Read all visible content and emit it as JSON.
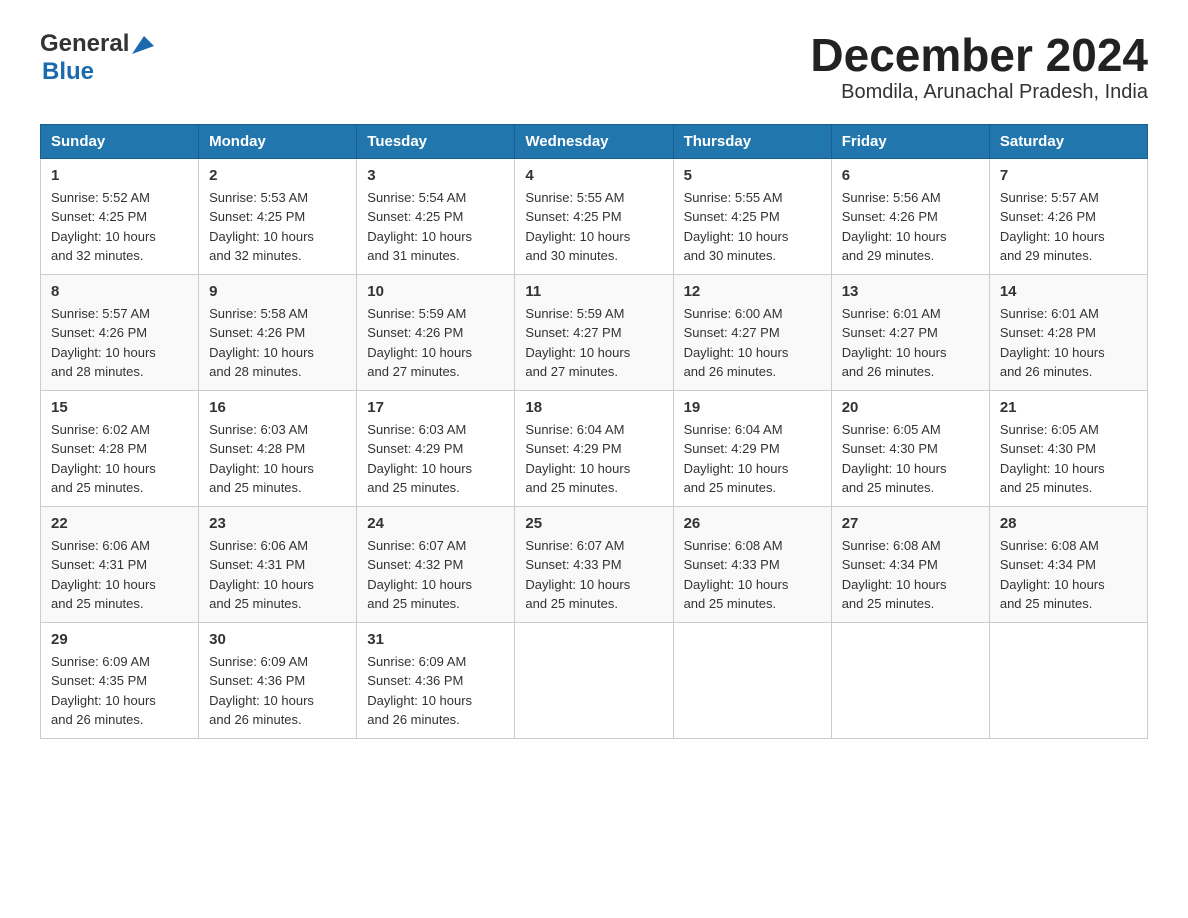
{
  "header": {
    "title": "December 2024",
    "subtitle": "Bomdila, Arunachal Pradesh, India",
    "logo_general": "General",
    "logo_blue": "Blue"
  },
  "weekdays": [
    "Sunday",
    "Monday",
    "Tuesday",
    "Wednesday",
    "Thursday",
    "Friday",
    "Saturday"
  ],
  "weeks": [
    [
      {
        "day": "1",
        "sunrise": "5:52 AM",
        "sunset": "4:25 PM",
        "daylight": "10 hours and 32 minutes."
      },
      {
        "day": "2",
        "sunrise": "5:53 AM",
        "sunset": "4:25 PM",
        "daylight": "10 hours and 32 minutes."
      },
      {
        "day": "3",
        "sunrise": "5:54 AM",
        "sunset": "4:25 PM",
        "daylight": "10 hours and 31 minutes."
      },
      {
        "day": "4",
        "sunrise": "5:55 AM",
        "sunset": "4:25 PM",
        "daylight": "10 hours and 30 minutes."
      },
      {
        "day": "5",
        "sunrise": "5:55 AM",
        "sunset": "4:25 PM",
        "daylight": "10 hours and 30 minutes."
      },
      {
        "day": "6",
        "sunrise": "5:56 AM",
        "sunset": "4:26 PM",
        "daylight": "10 hours and 29 minutes."
      },
      {
        "day": "7",
        "sunrise": "5:57 AM",
        "sunset": "4:26 PM",
        "daylight": "10 hours and 29 minutes."
      }
    ],
    [
      {
        "day": "8",
        "sunrise": "5:57 AM",
        "sunset": "4:26 PM",
        "daylight": "10 hours and 28 minutes."
      },
      {
        "day": "9",
        "sunrise": "5:58 AM",
        "sunset": "4:26 PM",
        "daylight": "10 hours and 28 minutes."
      },
      {
        "day": "10",
        "sunrise": "5:59 AM",
        "sunset": "4:26 PM",
        "daylight": "10 hours and 27 minutes."
      },
      {
        "day": "11",
        "sunrise": "5:59 AM",
        "sunset": "4:27 PM",
        "daylight": "10 hours and 27 minutes."
      },
      {
        "day": "12",
        "sunrise": "6:00 AM",
        "sunset": "4:27 PM",
        "daylight": "10 hours and 26 minutes."
      },
      {
        "day": "13",
        "sunrise": "6:01 AM",
        "sunset": "4:27 PM",
        "daylight": "10 hours and 26 minutes."
      },
      {
        "day": "14",
        "sunrise": "6:01 AM",
        "sunset": "4:28 PM",
        "daylight": "10 hours and 26 minutes."
      }
    ],
    [
      {
        "day": "15",
        "sunrise": "6:02 AM",
        "sunset": "4:28 PM",
        "daylight": "10 hours and 25 minutes."
      },
      {
        "day": "16",
        "sunrise": "6:03 AM",
        "sunset": "4:28 PM",
        "daylight": "10 hours and 25 minutes."
      },
      {
        "day": "17",
        "sunrise": "6:03 AM",
        "sunset": "4:29 PM",
        "daylight": "10 hours and 25 minutes."
      },
      {
        "day": "18",
        "sunrise": "6:04 AM",
        "sunset": "4:29 PM",
        "daylight": "10 hours and 25 minutes."
      },
      {
        "day": "19",
        "sunrise": "6:04 AM",
        "sunset": "4:29 PM",
        "daylight": "10 hours and 25 minutes."
      },
      {
        "day": "20",
        "sunrise": "6:05 AM",
        "sunset": "4:30 PM",
        "daylight": "10 hours and 25 minutes."
      },
      {
        "day": "21",
        "sunrise": "6:05 AM",
        "sunset": "4:30 PM",
        "daylight": "10 hours and 25 minutes."
      }
    ],
    [
      {
        "day": "22",
        "sunrise": "6:06 AM",
        "sunset": "4:31 PM",
        "daylight": "10 hours and 25 minutes."
      },
      {
        "day": "23",
        "sunrise": "6:06 AM",
        "sunset": "4:31 PM",
        "daylight": "10 hours and 25 minutes."
      },
      {
        "day": "24",
        "sunrise": "6:07 AM",
        "sunset": "4:32 PM",
        "daylight": "10 hours and 25 minutes."
      },
      {
        "day": "25",
        "sunrise": "6:07 AM",
        "sunset": "4:33 PM",
        "daylight": "10 hours and 25 minutes."
      },
      {
        "day": "26",
        "sunrise": "6:08 AM",
        "sunset": "4:33 PM",
        "daylight": "10 hours and 25 minutes."
      },
      {
        "day": "27",
        "sunrise": "6:08 AM",
        "sunset": "4:34 PM",
        "daylight": "10 hours and 25 minutes."
      },
      {
        "day": "28",
        "sunrise": "6:08 AM",
        "sunset": "4:34 PM",
        "daylight": "10 hours and 25 minutes."
      }
    ],
    [
      {
        "day": "29",
        "sunrise": "6:09 AM",
        "sunset": "4:35 PM",
        "daylight": "10 hours and 26 minutes."
      },
      {
        "day": "30",
        "sunrise": "6:09 AM",
        "sunset": "4:36 PM",
        "daylight": "10 hours and 26 minutes."
      },
      {
        "day": "31",
        "sunrise": "6:09 AM",
        "sunset": "4:36 PM",
        "daylight": "10 hours and 26 minutes."
      },
      null,
      null,
      null,
      null
    ]
  ],
  "label_sunrise": "Sunrise:",
  "label_sunset": "Sunset:",
  "label_daylight": "Daylight:"
}
